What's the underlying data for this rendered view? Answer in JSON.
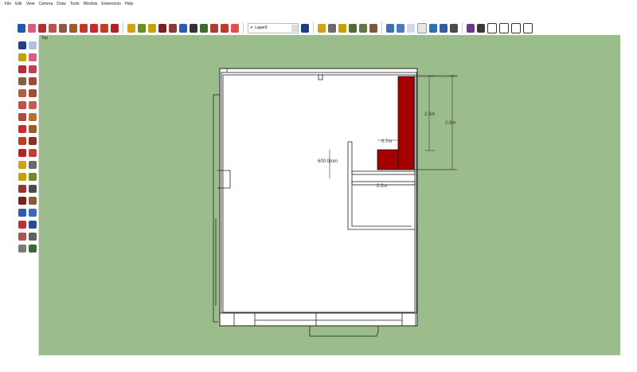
{
  "menu": {
    "items": [
      "File",
      "Edit",
      "View",
      "Camera",
      "Draw",
      "Tools",
      "Window",
      "Extensions",
      "Help"
    ]
  },
  "toolbar": {
    "layer_checkmark": "✔",
    "layer_name": "Layer0"
  },
  "viewport": {
    "view_label": "Top",
    "background_color": "#9bbd8c",
    "dimensions": {
      "dim_2_3": "2.3m",
      "dim_2_9": "2.9m",
      "dim_0_7": "0.7m",
      "dim_600": "600.0mm",
      "dim_2_2": "2.2m"
    },
    "red_fill_color": "#a40000"
  }
}
